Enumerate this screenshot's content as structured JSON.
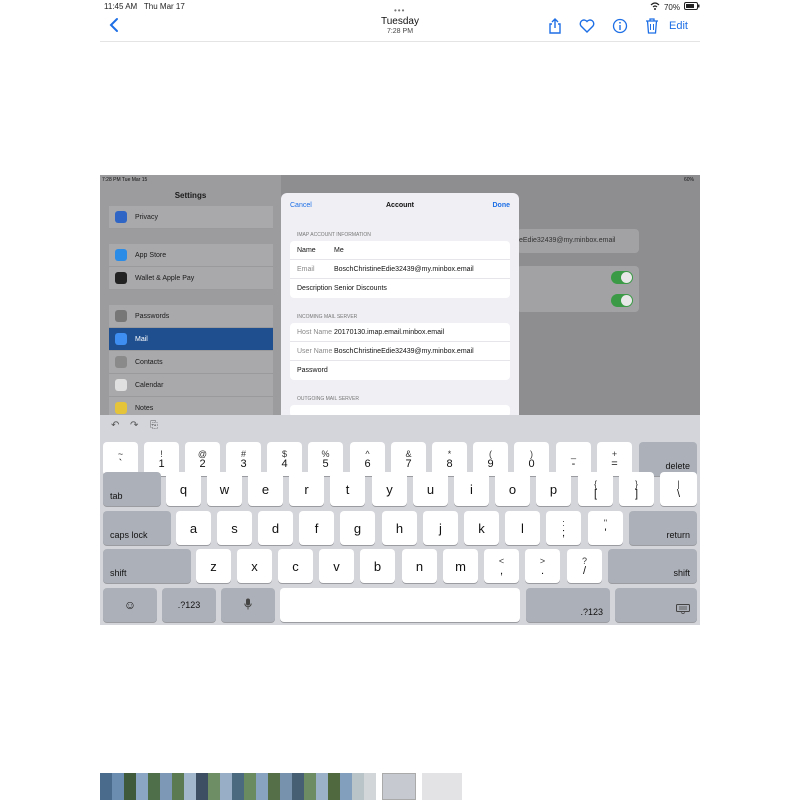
{
  "status_bar": {
    "time": "11:45 AM",
    "date": "Thu Mar 17",
    "battery": "70%"
  },
  "toolbar": {
    "title": "Tuesday",
    "subtitle": "7:28 PM",
    "edit_label": "Edit",
    "icons": [
      "chevron-left-icon",
      "share-icon",
      "heart-icon",
      "info-icon",
      "trash-icon"
    ],
    "accent_color": "#1e6fe6"
  },
  "photo": {
    "status_time": "7:28 PM   Tue Mar 15",
    "status_battery": "60%",
    "settings": {
      "title": "Settings",
      "items": [
        {
          "label": "Privacy",
          "icon": "hand-icon",
          "color": "#2f66c5"
        },
        {
          "label": "App Store",
          "icon": "app-store-icon",
          "color": "#2b8ce8"
        },
        {
          "label": "Wallet & Apple Pay",
          "icon": "wallet-icon",
          "color": "#222222"
        },
        {
          "label": "Passwords",
          "icon": "key-icon",
          "color": "#777777"
        },
        {
          "label": "Mail",
          "icon": "mail-icon",
          "color": "#3d8ef0",
          "selected": true
        },
        {
          "label": "Contacts",
          "icon": "contacts-icon",
          "color": "#8a8a8a"
        },
        {
          "label": "Calendar",
          "icon": "calendar-icon",
          "color": "#e0e0e0"
        },
        {
          "label": "Notes",
          "icon": "notes-icon",
          "color": "#e6c43a"
        }
      ]
    },
    "detail": {
      "email_fragment": "eEdie32439@my.minbox.email"
    },
    "modal": {
      "cancel": "Cancel",
      "title": "Account",
      "done": "Done",
      "imap_header": "IMAP ACCOUNT INFORMATION",
      "imap_rows": [
        {
          "label": "Name",
          "value": "Me"
        },
        {
          "label": "Email",
          "value": "BoschChristineEdie32439@my.minbox.email"
        },
        {
          "label": "Description",
          "value": "Senior Discounts"
        }
      ],
      "incoming_header": "INCOMING MAIL SERVER",
      "incoming_rows": [
        {
          "label": "Host Name",
          "value": "20170130.imap.email.minbox.email"
        },
        {
          "label": "User Name",
          "value": "BoschChristineEdie32439@my.minbox.email"
        },
        {
          "label": "Password",
          "value": ""
        }
      ],
      "outgoing_header": "OUTGOING MAIL SERVER"
    },
    "keyboard": {
      "number_row": [
        {
          "top": "~",
          "bottom": "`"
        },
        {
          "top": "!",
          "bottom": "1"
        },
        {
          "top": "@",
          "bottom": "2"
        },
        {
          "top": "#",
          "bottom": "3"
        },
        {
          "top": "$",
          "bottom": "4"
        },
        {
          "top": "%",
          "bottom": "5"
        },
        {
          "top": "^",
          "bottom": "6"
        },
        {
          "top": "&",
          "bottom": "7"
        },
        {
          "top": "*",
          "bottom": "8"
        },
        {
          "top": "(",
          "bottom": "9"
        },
        {
          "top": ")",
          "bottom": "0"
        },
        {
          "top": "_",
          "bottom": "-"
        },
        {
          "top": "+",
          "bottom": "="
        }
      ],
      "delete": "delete",
      "tab": "tab",
      "row2": [
        "q",
        "w",
        "e",
        "r",
        "t",
        "y",
        "u",
        "i",
        "o",
        "p"
      ],
      "row2_tail": [
        {
          "top": "{",
          "bottom": "["
        },
        {
          "top": "}",
          "bottom": "]"
        },
        {
          "top": "|",
          "bottom": "\\"
        }
      ],
      "caps": "caps lock",
      "row3": [
        "a",
        "s",
        "d",
        "f",
        "g",
        "h",
        "j",
        "k",
        "l"
      ],
      "row3_tail": [
        {
          "top": ":",
          "bottom": ";"
        },
        {
          "top": "\"",
          "bottom": "'"
        }
      ],
      "return": "return",
      "shift": "shift",
      "row4": [
        "z",
        "x",
        "c",
        "v",
        "b",
        "n",
        "m"
      ],
      "row4_tail": [
        {
          "top": "<",
          "bottom": ","
        },
        {
          "top": ">",
          "bottom": "."
        },
        {
          "top": "?",
          "bottom": "/"
        }
      ],
      "numbers_key": ".?123"
    }
  }
}
